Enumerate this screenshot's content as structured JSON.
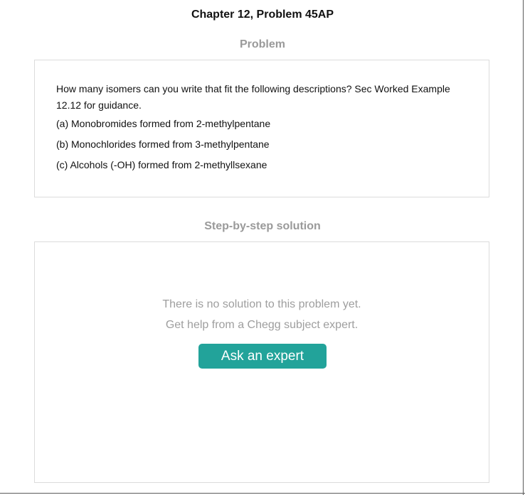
{
  "page": {
    "title": "Chapter 12, Problem 45AP"
  },
  "problem": {
    "heading": "Problem",
    "question": "How many isomers can you write that fit the following descriptions? Sec Worked Example 12.12 for guidance.",
    "parts": [
      "(a) Monobromides formed from 2-methylpentane",
      "(b) Monochlorides formed from 3-methylpentane",
      "(c) Alcohols (-OH) formed from 2-methyllsexane"
    ]
  },
  "solution": {
    "heading": "Step-by-step solution",
    "no_solution_text": "There is no solution to this problem yet.",
    "help_text": "Get help from a Chegg subject expert.",
    "ask_button_label": "Ask an expert"
  },
  "colors": {
    "accent": "#22a39a",
    "heading_gray": "#9a9a9a",
    "panel_border": "#dcdcdc"
  }
}
